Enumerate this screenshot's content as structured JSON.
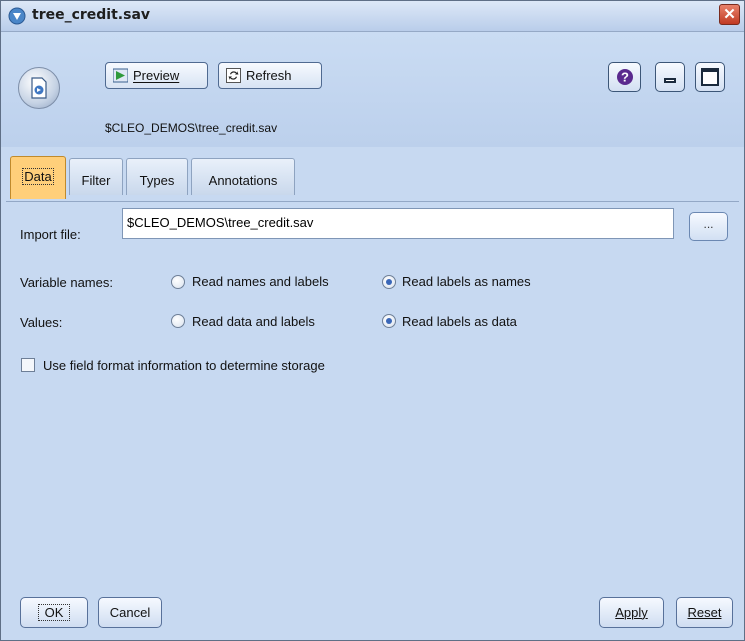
{
  "window": {
    "title": "tree_credit.sav",
    "close_icon": "✕"
  },
  "toolbar": {
    "preview_label": "Preview",
    "refresh_label": "Refresh",
    "node_path": "$CLEO_DEMOS\\tree_credit.sav"
  },
  "tabs": [
    {
      "label": "Data",
      "active": true
    },
    {
      "label": "Filter",
      "active": false
    },
    {
      "label": "Types",
      "active": false
    },
    {
      "label": "Annotations",
      "active": false
    }
  ],
  "data_tab": {
    "import_file_label": "Import file:",
    "import_file_value": "$CLEO_DEMOS\\tree_credit.sav",
    "browse_label": "...",
    "variable_names_label": "Variable names:",
    "variable_names_options": [
      {
        "label": "Read names and labels",
        "checked": false
      },
      {
        "label": "Read labels as names",
        "checked": true
      }
    ],
    "values_label": "Values:",
    "values_options": [
      {
        "label": "Read data and labels",
        "checked": false
      },
      {
        "label": "Read labels as data",
        "checked": true
      }
    ],
    "field_format_label": "Use field format information to determine storage",
    "field_format_checked": false
  },
  "buttons": {
    "ok": "OK",
    "cancel": "Cancel",
    "apply": "Apply",
    "reset": "Reset"
  },
  "colors": {
    "background": "#c7d9f1",
    "active_tab": "#ffcf7a",
    "close_button": "#c13a23"
  }
}
